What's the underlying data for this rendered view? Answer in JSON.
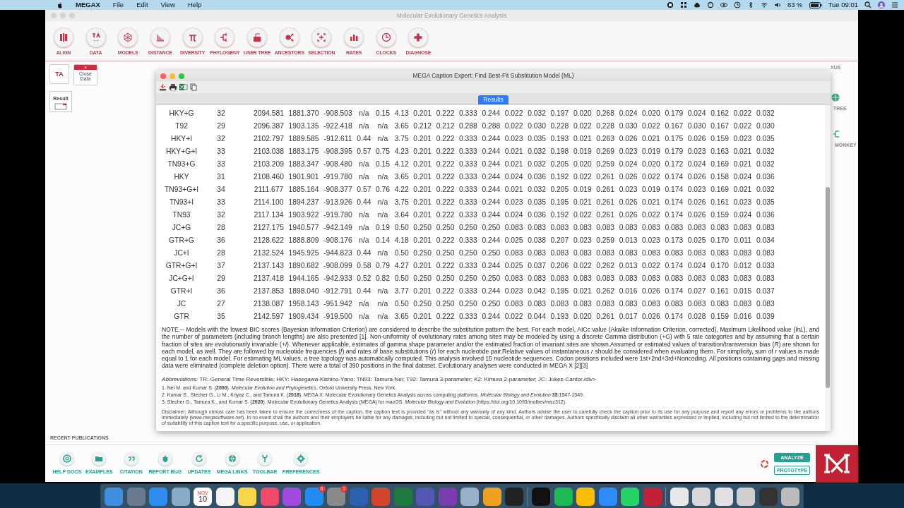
{
  "menu_bar": {
    "app": "MEGAX",
    "items": [
      "File",
      "Edit",
      "View",
      "Help"
    ],
    "battery": "83 %",
    "clock": "Tue 09:01"
  },
  "window": {
    "title": "Molecular Evolutionary Genetics Analysis"
  },
  "toolbar": [
    "ALIGN",
    "DATA",
    "MODELS",
    "DISTANCE",
    "DIVERSITY",
    "PHYLOGENY",
    "USER TREE",
    "ANCESTORS",
    "SELECTION",
    "RATES",
    "CLOCKS",
    "DIAGNOSE"
  ],
  "side_panel": {
    "data_icon": "TA",
    "close_button": {
      "mark": "×",
      "label": "Close Data"
    },
    "result_icon": "Result",
    "recent_heading": "RECENT PUBLICATIONS"
  },
  "background_labels": [
    "XUS",
    "TREE",
    "MONKEY"
  ],
  "caption_window": {
    "title": "MEGA Caption Expert: Find Best-Fit Substitution Model (ML)",
    "tabs": [
      {
        "label": "Results",
        "selected": true
      }
    ],
    "table": {
      "rows": [
        {
          "cells": [
            "HKY+G",
            "32",
            "2094.581",
            "1881.370",
            "-908.503",
            "n/a",
            "0.15",
            "4.13",
            "0.201",
            "0.222",
            "0.333",
            "0.244",
            "0.022",
            "0.032",
            "0.197",
            "0.020",
            "0.268",
            "0.024",
            "0.020",
            "0.179",
            "0.024",
            "0.162",
            "0.022",
            "0.032"
          ]
        },
        {
          "cells": [
            "T92",
            "29",
            "2096.387",
            "1903.135",
            "-922.418",
            "n/a",
            "n/a",
            "3.65",
            "0.212",
            "0.212",
            "0.288",
            "0.288",
            "0.022",
            "0.030",
            "0.228",
            "0.022",
            "0.228",
            "0.030",
            "0.022",
            "0.167",
            "0.030",
            "0.167",
            "0.022",
            "0.030"
          ]
        },
        {
          "cells": [
            "HKY+I",
            "32",
            "2102.797",
            "1889.585",
            "-912.611",
            "0.44",
            "n/a",
            "3.75",
            "0.201",
            "0.222",
            "0.333",
            "0.244",
            "0.023",
            "0.035",
            "0.193",
            "0.021",
            "0.263",
            "0.026",
            "0.021",
            "0.175",
            "0.026",
            "0.159",
            "0.023",
            "0.035"
          ]
        },
        {
          "cells": [
            "HKY+G+I",
            "33",
            "2103.038",
            "1883.175",
            "-908.395",
            "0.57",
            "0.75",
            "4.23",
            "0.201",
            "0.222",
            "0.333",
            "0.244",
            "0.021",
            "0.032",
            "0.198",
            "0.019",
            "0.269",
            "0.023",
            "0.019",
            "0.179",
            "0.023",
            "0.163",
            "0.021",
            "0.032"
          ]
        },
        {
          "cells": [
            "TN93+G",
            "33",
            "2103.209",
            "1883.347",
            "-908.480",
            "n/a",
            "0.15",
            "4.12",
            "0.201",
            "0.222",
            "0.333",
            "0.244",
            "0.021",
            "0.032",
            "0.205",
            "0.020",
            "0.259",
            "0.024",
            "0.020",
            "0.172",
            "0.024",
            "0.169",
            "0.021",
            "0.032"
          ]
        },
        {
          "cells": [
            "HKY",
            "31",
            "2108.460",
            "1901.901",
            "-919.780",
            "n/a",
            "n/a",
            "3.65",
            "0.201",
            "0.222",
            "0.333",
            "0.244",
            "0.024",
            "0.036",
            "0.192",
            "0.022",
            "0.261",
            "0.026",
            "0.022",
            "0.174",
            "0.026",
            "0.158",
            "0.024",
            "0.036"
          ]
        },
        {
          "cells": [
            "TN93+G+I",
            "34",
            "2111.677",
            "1885.164",
            "-908.377",
            "0.57",
            "0.76",
            "4.22",
            "0.201",
            "0.222",
            "0.333",
            "0.244",
            "0.021",
            "0.032",
            "0.205",
            "0.019",
            "0.261",
            "0.023",
            "0.019",
            "0.174",
            "0.023",
            "0.169",
            "0.021",
            "0.032"
          ]
        },
        {
          "cells": [
            "TN93+I",
            "33",
            "2114.100",
            "1894.237",
            "-913.926",
            "0.44",
            "n/a",
            "3.75",
            "0.201",
            "0.222",
            "0.333",
            "0.244",
            "0.023",
            "0.035",
            "0.195",
            "0.021",
            "0.261",
            "0.026",
            "0.021",
            "0.174",
            "0.026",
            "0.161",
            "0.023",
            "0.035"
          ]
        },
        {
          "cells": [
            "TN93",
            "32",
            "2117.134",
            "1903.922",
            "-919.780",
            "n/a",
            "n/a",
            "3.64",
            "0.201",
            "0.222",
            "0.333",
            "0.244",
            "0.024",
            "0.036",
            "0.192",
            "0.022",
            "0.261",
            "0.026",
            "0.022",
            "0.174",
            "0.026",
            "0.159",
            "0.024",
            "0.036"
          ]
        },
        {
          "cells": [
            "JC+G",
            "28",
            "2127.175",
            "1940.577",
            "-942.149",
            "n/a",
            "0.19",
            "0.50",
            "0.250",
            "0.250",
            "0.250",
            "0.250",
            "0.083",
            "0.083",
            "0.083",
            "0.083",
            "0.083",
            "0.083",
            "0.083",
            "0.083",
            "0.083",
            "0.083",
            "0.083",
            "0.083"
          ]
        },
        {
          "cells": [
            "GTR+G",
            "36",
            "2128.622",
            "1888.809",
            "-908.176",
            "n/a",
            "0.14",
            "4.18",
            "0.201",
            "0.222",
            "0.333",
            "0.244",
            "0.025",
            "0.038",
            "0.207",
            "0.023",
            "0.259",
            "0.013",
            "0.023",
            "0.173",
            "0.025",
            "0.170",
            "0.011",
            "0.034"
          ]
        },
        {
          "cells": [
            "JC+I",
            "28",
            "2132.524",
            "1945.925",
            "-944.823",
            "0.44",
            "n/a",
            "0.50",
            "0.250",
            "0.250",
            "0.250",
            "0.250",
            "0.083",
            "0.083",
            "0.083",
            "0.083",
            "0.083",
            "0.083",
            "0.083",
            "0.083",
            "0.083",
            "0.083",
            "0.083",
            "0.083"
          ]
        },
        {
          "cells": [
            "GTR+G+I",
            "37",
            "2137.143",
            "1890.682",
            "-908.099",
            "0.58",
            "0.79",
            "4.27",
            "0.201",
            "0.222",
            "0.333",
            "0.244",
            "0.025",
            "0.037",
            "0.206",
            "0.022",
            "0.262",
            "0.013",
            "0.022",
            "0.174",
            "0.024",
            "0.170",
            "0.012",
            "0.033"
          ]
        },
        {
          "cells": [
            "JC+G+I",
            "29",
            "2137.418",
            "1944.165",
            "-942.933",
            "0.52",
            "0.82",
            "0.50",
            "0.250",
            "0.250",
            "0.250",
            "0.250",
            "0.083",
            "0.083",
            "0.083",
            "0.083",
            "0.083",
            "0.083",
            "0.083",
            "0.083",
            "0.083",
            "0.083",
            "0.083",
            "0.083"
          ]
        },
        {
          "cells": [
            "GTR+I",
            "36",
            "2137.853",
            "1898.040",
            "-912.791",
            "0.44",
            "n/a",
            "3.77",
            "0.201",
            "0.222",
            "0.333",
            "0.244",
            "0.023",
            "0.042",
            "0.195",
            "0.021",
            "0.262",
            "0.016",
            "0.026",
            "0.174",
            "0.027",
            "0.161",
            "0.015",
            "0.037"
          ]
        },
        {
          "cells": [
            "JC",
            "27",
            "2138.087",
            "1958.143",
            "-951.942",
            "n/a",
            "n/a",
            "0.50",
            "0.250",
            "0.250",
            "0.250",
            "0.250",
            "0.083",
            "0.083",
            "0.083",
            "0.083",
            "0.083",
            "0.083",
            "0.083",
            "0.083",
            "0.083",
            "0.083",
            "0.083",
            "0.083"
          ]
        },
        {
          "cells": [
            "GTR",
            "35",
            "2142.597",
            "1909.434",
            "-919.500",
            "n/a",
            "n/a",
            "3.65",
            "0.201",
            "0.222",
            "0.333",
            "0.244",
            "0.022",
            "0.044",
            "0.193",
            "0.020",
            "0.261",
            "0.017",
            "0.026",
            "0.174",
            "0.028",
            "0.159",
            "0.016",
            "0.039"
          ]
        }
      ]
    },
    "note": "NOTE.-- Models with the lowest BIC scores (Bayesian Information Criterion) are considered to describe the substitution pattern the best. For each model, AICc value (Akaike Information Criterion, corrected), Maximum Likelihood value (*lnL*), and the number of parameters (including branch lengths) are also presented [1]. Non-uniformity of evolutionary rates among sites may be modeled by using a discrete Gamma distribution (*+G*) with 5 rate categories and by assuming that a certain fraction of sites are evolutionarily invariable (*+I*). Whenever applicable, estimates of gamma shape parameter and/or the estimated fraction of invariant sites are shown.Assumed or estimated values of transition/transversion bias (*R*) are shown for each model, as well. They are followed by nucleotide frequencies (*f*) and rates of base substitutions (*r*) for each nucleotide pair.Relative values of instantaneous *r* should be considered when evaluating them. For simplicity, sum of *r* values is made equal to 1 for each model. For estimating ML values, a tree topology was automatically computed. This analysis involved 15 nucleotide sequences. Codon positions included were 1st+2nd+3rd+Noncoding. All positions containing gaps and missing data were eliminated (complete deletion option). There were a total of 390 positions in the final dataset. Evolutionary analyses were conducted in MEGA X [2][3]",
    "abbreviations": "*Abbreviations:* TR: General Time Reversible; HKY: Hasegawa-Kishino-Yano; TN93: Tamura-Nei; T92: Tamura 3-parameter; K2: Kimura 2-parameter; JC: Jukes-Cantor./div>",
    "references": [
      "1. Nei M. and Kumar S. (**2000**). *Molecular Evolution and Phylogenetics*. Oxford University Press, New York.",
      "2. Kumar S., Stecher G., Li M., Knyaz C., and Tamura K. (**2018**). MEGA X: Molecular Evolutionary Genetics Analysis across computing platforms. *Molecular Biology and Evolution* **35**:1547-1549.",
      "3. Stecher G., Tamura K., and Kumar S. (**2020**). Molecular Evolutionary Genetics Analysis (MEGA) for macOS. *Molecular Biology and Evolution* (https://doi.org/10.1093/molbev/msz312)."
    ],
    "disclaimer": "Disclaimer: Although utmost care has been taken to ensure the correctness of the caption, the caption text is provided \"as is\" without any warranty of any kind. Authors advise the user to carefully check the caption prior to its use for any purpose and report any errors or problems to the authors immediately (www.megasoftware.net). In no event shall the authors and their employers be liable for any damages, including but not limited to special, consequential, or other damages. Authors specifically disclaim all other warranties expressed or implied, including but not limited to the determination of suitability of this caption text for a specific purpose, use, or application."
  },
  "bottom_bar": [
    "HELP DOCS",
    "EXAMPLES",
    "CITATION",
    "REPORT BUG",
    "UPDATES",
    "MEGA LINKS",
    "TOOLBAR",
    "PREFERENCES"
  ],
  "mode_buttons": [
    "ANALYZE",
    "PROTOTYPE"
  ],
  "dock": {
    "calendar_month": "NOV",
    "calendar_day": "10",
    "badges": [
      "6",
      "1"
    ]
  }
}
